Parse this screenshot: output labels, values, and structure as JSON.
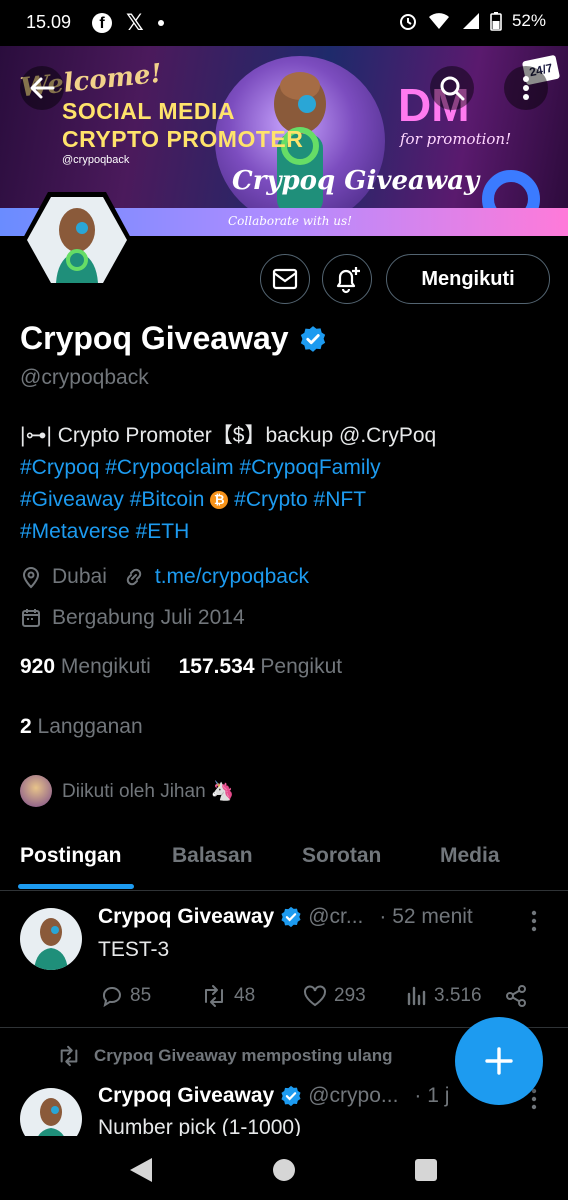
{
  "status_bar": {
    "time": "15.09",
    "battery": "52%"
  },
  "banner": {
    "welcome": "Welcome!",
    "line1": "SOCIAL MEDIA",
    "line2": "CRYPTO PROMOTER",
    "handle": "@crypoqback",
    "dm": "DM",
    "for_promotion": "for promotion!",
    "badge": "24/7",
    "name": "Crypoq Giveaway",
    "collab": "Collaborate with us!"
  },
  "profile": {
    "follow_label": "Mengikuti",
    "name": "Crypoq Giveaway",
    "handle": "@crypoqback",
    "bio_line1": "|⊶| Crypto Promoter【$】backup @.CryPoq",
    "tags": [
      "#Crypoq",
      "#Crypoqclaim",
      "#CrypoqFamily",
      "#Giveaway",
      "#Bitcoin",
      "#Crypto",
      "#NFT",
      "#Metaverse",
      "#ETH"
    ],
    "bitcoin_emoji": "₿",
    "location": "Dubai",
    "link": "t.me/crypoqback",
    "joined": "Bergabung Juli 2014",
    "following_count": "920",
    "following_label": "Mengikuti",
    "followers_count": "157.534",
    "followers_label": "Pengikut",
    "subs_count": "2",
    "subs_label": "Langganan",
    "followed_by": "Diikuti oleh Jihan 🦄"
  },
  "tabs": [
    "Postingan",
    "Balasan",
    "Sorotan",
    "Media"
  ],
  "posts": [
    {
      "name": "Crypoq Giveaway",
      "handle": "@cr...",
      "time": "· 52 menit",
      "text": "TEST-3",
      "replies": "85",
      "reposts": "48",
      "likes": "293",
      "views": "3.516"
    },
    {
      "repost_label": "Crypoq Giveaway memposting ulang",
      "name": "Crypoq Giveaway",
      "handle": "@crypo...",
      "time": "· 1 j",
      "text": "Number pick (1-1000)"
    }
  ],
  "colors": {
    "accent": "#1d9bf0",
    "muted": "#71767b",
    "background": "#000000"
  }
}
